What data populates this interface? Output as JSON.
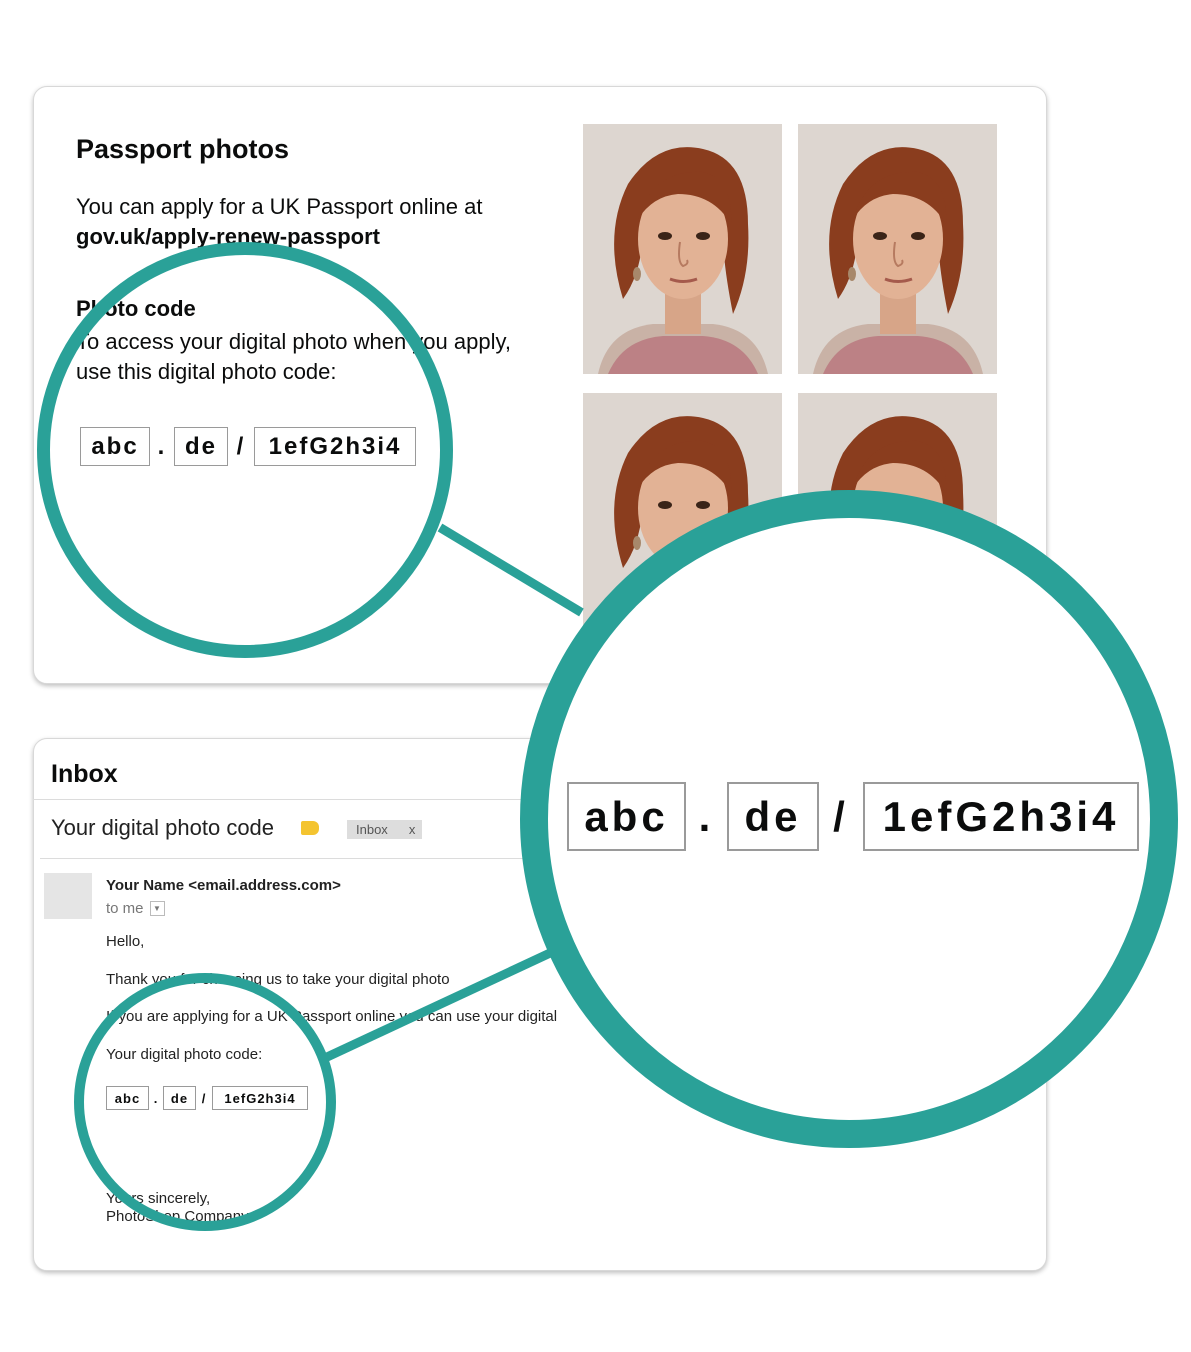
{
  "photo_card": {
    "title": "Passport photos",
    "intro": "You can apply for a UK Passport online at",
    "link": "gov.uk/apply-renew-passport",
    "code_heading": "Photo code",
    "code_text_1": "To access your digital photo when you apply,",
    "code_text_2": "use this digital photo code:"
  },
  "code": {
    "part1": "abc",
    "sep1": ".",
    "part2": "de",
    "sep2": "/",
    "part3": "1efG2h3i4"
  },
  "email": {
    "folder": "Inbox",
    "subject": "Your digital photo code",
    "label": "Inbox",
    "label_close": "x",
    "sender": "Your Name <email.address.com>",
    "to": "to me",
    "greeting": "Hello,",
    "line1": "Thank you for choosing us to take your digital photo",
    "line2": "If you are applying for a UK Passport online you can use your digital",
    "line3": "Your digital photo code:",
    "signoff": "Yours sincerely,",
    "company": "PhotoShop Company"
  },
  "colors": {
    "accent": "#2aa198",
    "tag": "#f4c430"
  }
}
